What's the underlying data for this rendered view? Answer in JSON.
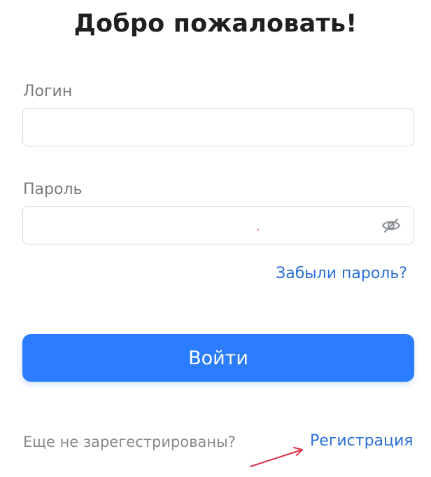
{
  "header": {
    "title": "Добро пожаловать!"
  },
  "login_field": {
    "label": "Логин",
    "value": "",
    "placeholder": ""
  },
  "password_field": {
    "label": "Пароль",
    "value": "",
    "placeholder": "",
    "toggle_icon": "eye-off-icon"
  },
  "forgot_password": {
    "label": "Забыли пароль?"
  },
  "submit": {
    "label": "Войти"
  },
  "register": {
    "prompt": "Еще не зарегестрированы?",
    "link_label": "Регистрация"
  },
  "colors": {
    "primary": "#2b7cff",
    "link": "#2a6fd6",
    "label": "#7a7a7a",
    "annotation": "#e0334a"
  }
}
